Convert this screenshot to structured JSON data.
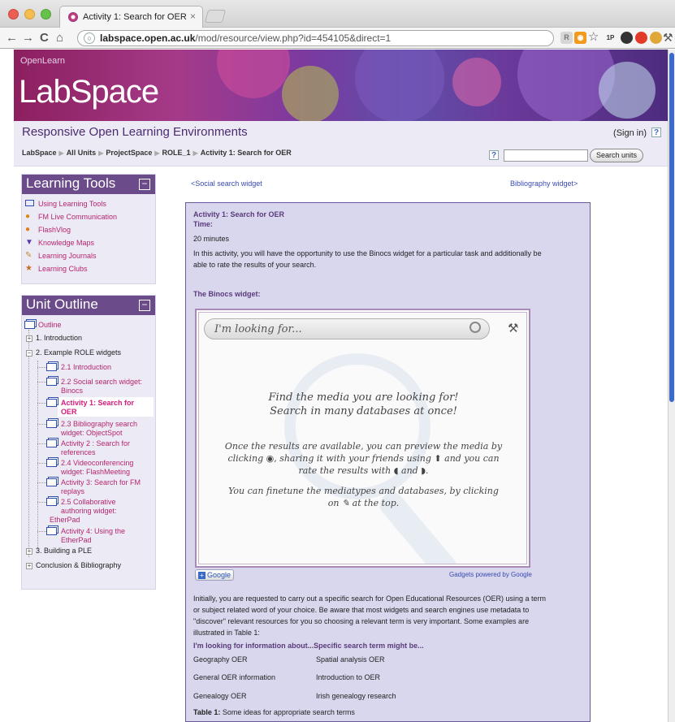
{
  "browser": {
    "tab_title": "Activity 1: Search for OER",
    "tab_close": "×",
    "url_host": "labspace.open.ac.uk",
    "url_path": "/mod/resource/view.php?id=454105&direct=1",
    "ext_1p": "1P"
  },
  "banner": {
    "small": "OpenLearn",
    "big": "LabSpace"
  },
  "site": {
    "title": "Responsive Open Learning Environments",
    "signin": "(Sign in)",
    "help": "?"
  },
  "breadcrumbs": [
    "LabSpace",
    "All Units",
    "ProjectSpace",
    "ROLE_1",
    "Activity 1: Search for OER"
  ],
  "search": {
    "help": "?",
    "button": "Search units"
  },
  "learning_tools": {
    "title": "Learning Tools",
    "items": [
      "Using Learning Tools",
      "FM Live Communication",
      "FlashVlog",
      "Knowledge Maps",
      "Learning Journals",
      "Learning Clubs"
    ]
  },
  "unit_outline": {
    "title": "Unit Outline",
    "outline": "Outline",
    "introduction": "1. Introduction",
    "example_widgets": "2. Example ROLE widgets",
    "sub_items": [
      [
        "2.1 Introduction"
      ],
      [
        "2.2 Social search widget:",
        "Binocs"
      ],
      [
        "Activity 1: Search for",
        "OER"
      ],
      [
        "2.3 Bibliography search",
        "widget: ObjectSpot"
      ],
      [
        "Activity 2 : Search for",
        "references"
      ],
      [
        "2.4 Videoconferencing",
        "widget: FlashMeeting"
      ],
      [
        "Activity 3: Search for FM",
        "replays"
      ],
      [
        "2.5 Collaborative",
        "authoring widget:",
        "EtherPad"
      ],
      [
        "Activity 4: Using the",
        "EtherPad"
      ]
    ],
    "building": "3. Building a PLE",
    "conclusion": "Conclusion & Bibliography"
  },
  "content": {
    "prev_link": "<Social search widget",
    "next_link": "Bibliography widget>",
    "activity_title": "Activity 1: Search for OER",
    "time_label": "Time:",
    "time_value": "20 minutes",
    "intro_1": "In this activity, you will have the opportunity to use the Binocs widget for a particular task and additionally be",
    "intro_2": "able to rate the results of your search.",
    "widget_heading": "The Binocs widget:",
    "widget": {
      "search_placeholder": "I'm looking for...",
      "find_1": "Find the media you are looking for!",
      "find_2": "Search in many databases at once!",
      "once_1": "Once the results are available, you can preview the media by",
      "once_2": "clicking ◉, sharing it with your friends using ⬆ and you can",
      "once_3": "rate the results with ◖ and ◗.",
      "fine_1": "You can finetune the mediatypes and databases, by clicking",
      "fine_2": "on ✎ at the top."
    },
    "google_button": "Google",
    "powered_by": "Gadgets powered by Google",
    "para_1": "Initially, you are requested to carry out a specific search for Open Educational Resources (OER) using a term",
    "para_2": "or subject related word of your choice. Be aware that most widgets and search engines use metadata to",
    "para_3": "\"discover\" relevant resources for you so choosing a relevant term is very important. Some examples are",
    "para_4": "illustrated in Table 1:",
    "table_header": "I'm looking for information about...Specific search term might be...",
    "table_rows": [
      [
        "Geography OER",
        "Spatial analysis OER"
      ],
      [
        "General OER information",
        "Introduction to OER"
      ],
      [
        "Genealogy OER",
        "Irish genealogy research"
      ]
    ],
    "caption_bold": "Table 1:",
    "caption_text": " Some ideas for appropriate search terms"
  }
}
